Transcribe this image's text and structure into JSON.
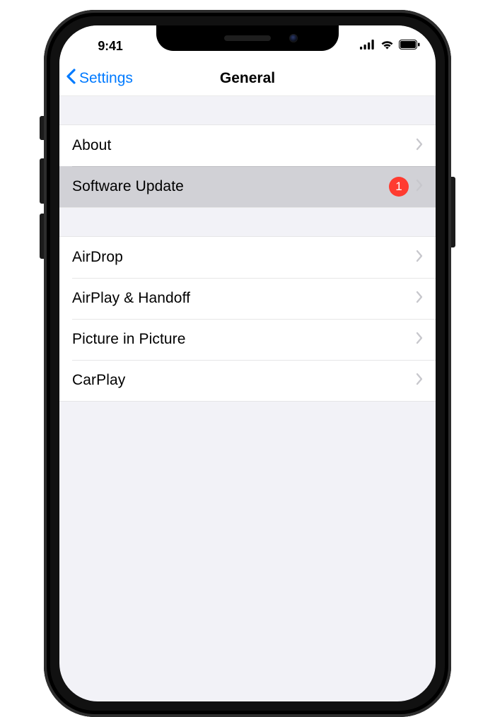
{
  "status": {
    "time": "9:41"
  },
  "nav": {
    "back_label": "Settings",
    "title": "General"
  },
  "groups": [
    {
      "rows": [
        {
          "key": "about",
          "label": "About",
          "badge": null,
          "selected": false
        },
        {
          "key": "software-update",
          "label": "Software Update",
          "badge": "1",
          "selected": true
        }
      ]
    },
    {
      "rows": [
        {
          "key": "airdrop",
          "label": "AirDrop",
          "badge": null,
          "selected": false
        },
        {
          "key": "airplay-handoff",
          "label": "AirPlay & Handoff",
          "badge": null,
          "selected": false
        },
        {
          "key": "picture-in-picture",
          "label": "Picture in Picture",
          "badge": null,
          "selected": false
        },
        {
          "key": "carplay",
          "label": "CarPlay",
          "badge": null,
          "selected": false
        }
      ]
    }
  ]
}
